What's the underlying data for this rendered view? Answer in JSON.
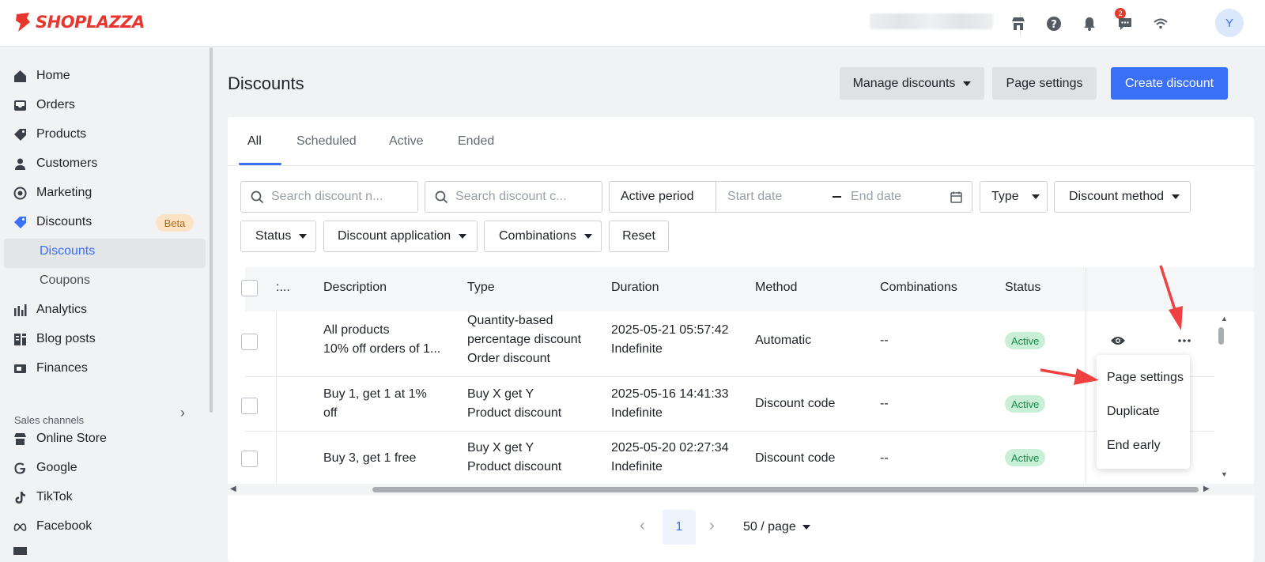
{
  "app": {
    "brand": "SHOPLAZZA",
    "avatar_initial": "Y",
    "notification_count": "2",
    "accent": "#3a6ff7"
  },
  "topbar_icons": [
    "store-icon",
    "help-icon",
    "bell-icon",
    "chat-icon",
    "wifi-icon"
  ],
  "sidebar": {
    "items": [
      {
        "label": "Home",
        "icon": "home-icon"
      },
      {
        "label": "Orders",
        "icon": "inbox-icon"
      },
      {
        "label": "Products",
        "icon": "tag-icon"
      },
      {
        "label": "Customers",
        "icon": "person-icon"
      },
      {
        "label": "Marketing",
        "icon": "target-icon"
      },
      {
        "label": "Discounts",
        "icon": "discount-tag-icon",
        "badge": "Beta"
      },
      {
        "label": "Analytics",
        "icon": "bar-chart-icon"
      },
      {
        "label": "Blog posts",
        "icon": "blog-icon"
      },
      {
        "label": "Finances",
        "icon": "finance-icon"
      }
    ],
    "sub_items": [
      "Discounts",
      "Coupons"
    ],
    "sales_channels_title": "Sales channels",
    "channels": [
      {
        "label": "Online Store",
        "icon": "store-icon"
      },
      {
        "label": "Google",
        "icon": "google-icon"
      },
      {
        "label": "TikTok",
        "icon": "tiktok-icon"
      },
      {
        "label": "Facebook",
        "icon": "meta-icon"
      }
    ]
  },
  "header": {
    "title": "Discounts",
    "manage_label": "Manage discounts",
    "page_settings_label": "Page settings",
    "create_label": "Create discount"
  },
  "tabs": [
    "All",
    "Scheduled",
    "Active",
    "Ended"
  ],
  "filters": {
    "search_name_placeholder": "Search discount n...",
    "search_code_placeholder": "Search discount c...",
    "active_period_label": "Active period",
    "start_placeholder": "Start date",
    "end_placeholder": "End date",
    "type_label": "Type",
    "method_label": "Discount method",
    "status_label": "Status",
    "application_label": "Discount application",
    "combinations_label": "Combinations",
    "reset_label": "Reset"
  },
  "table": {
    "headers": [
      ":...",
      "Description",
      "Type",
      "Duration",
      "Method",
      "Combinations",
      "Status"
    ],
    "rows": [
      {
        "desc1": "All products",
        "desc2": "10% off orders of 1...",
        "type1": "Quantity-based",
        "type2": "percentage discount",
        "type3": "Order discount",
        "dur1": "2025-05-21 05:57:42",
        "dur2": "Indefinite",
        "method": "Automatic",
        "comb": "--",
        "status": "Active"
      },
      {
        "desc1": "Buy 1, get 1 at 1%",
        "desc2": "off",
        "type1": "Buy X get Y",
        "type2": "Product discount",
        "dur1": "2025-05-16 14:41:33",
        "dur2": "Indefinite",
        "method": "Discount code",
        "comb": "--",
        "status": "Active"
      },
      {
        "desc1": "Buy 3, get 1 free",
        "type1": "Buy X get Y",
        "type2": "Product discount",
        "dur1": "2025-05-20 02:27:34",
        "dur2": "Indefinite",
        "method": "Discount code",
        "comb": "--",
        "status": "Active"
      }
    ]
  },
  "row_menu": [
    "Page settings",
    "Duplicate",
    "End early"
  ],
  "pagination": {
    "current": "1",
    "page_size": "50 / page"
  }
}
